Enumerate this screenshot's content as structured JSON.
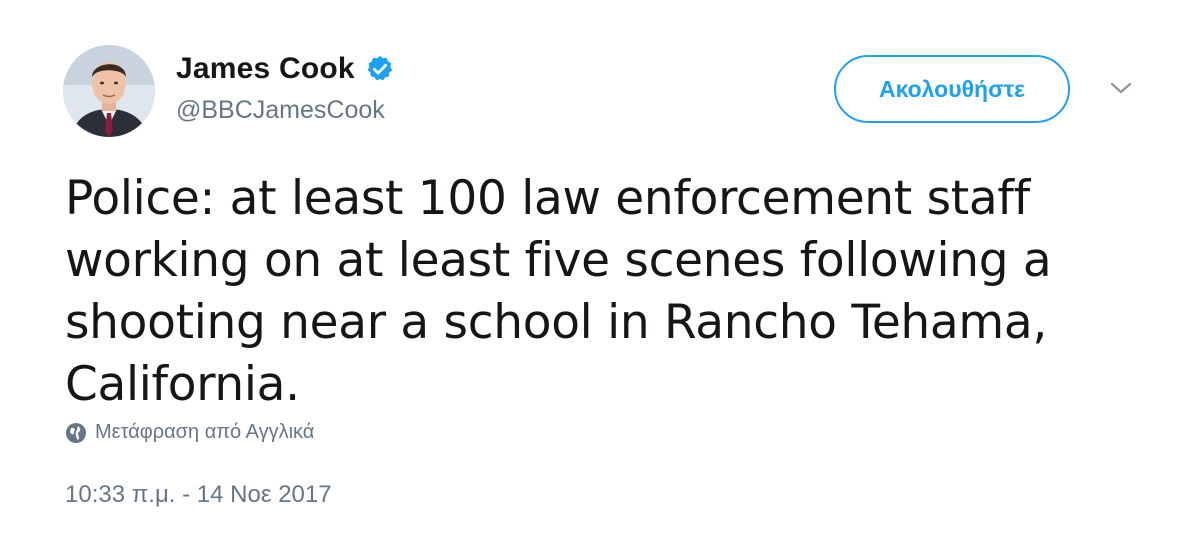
{
  "tweet": {
    "author": {
      "display_name": "James Cook",
      "handle": "@BBCJamesCook",
      "verified": true
    },
    "follow_button_label": "Ακολουθήστε",
    "text": "Police: at least 100 law enforcement staff working on at least five scenes following a shooting near a school in Rancho Tehama, California.",
    "translate_label": "Μετάφραση από Αγγλικά",
    "timestamp": "10:33 π.μ. - 14 Νοε 2017"
  },
  "colors": {
    "accent": "#1da1f2",
    "text_primary": "#14171a",
    "text_secondary": "#657786"
  },
  "icons": {
    "verified": "verified-badge-icon",
    "menu": "chevron-down-icon",
    "translate": "globe-icon"
  }
}
